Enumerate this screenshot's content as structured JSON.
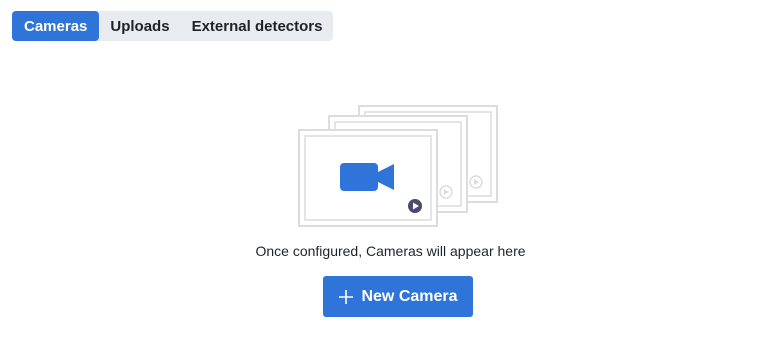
{
  "tabs": [
    {
      "label": "Cameras",
      "active": true
    },
    {
      "label": "Uploads",
      "active": false
    },
    {
      "label": "External detectors",
      "active": false
    }
  ],
  "empty_state": {
    "illustration_icon": "video-camera-icon",
    "play_icon": "play-icon",
    "message": "Once configured, Cameras will appear here"
  },
  "new_camera_button": {
    "label": "New Camera",
    "icon": "plus-icon"
  },
  "colors": {
    "accent": "#2f74d9",
    "tab_bar_bg": "#e8ebef",
    "frame_stroke": "#dcdcdc",
    "play_badge": "#4a4a6a"
  }
}
